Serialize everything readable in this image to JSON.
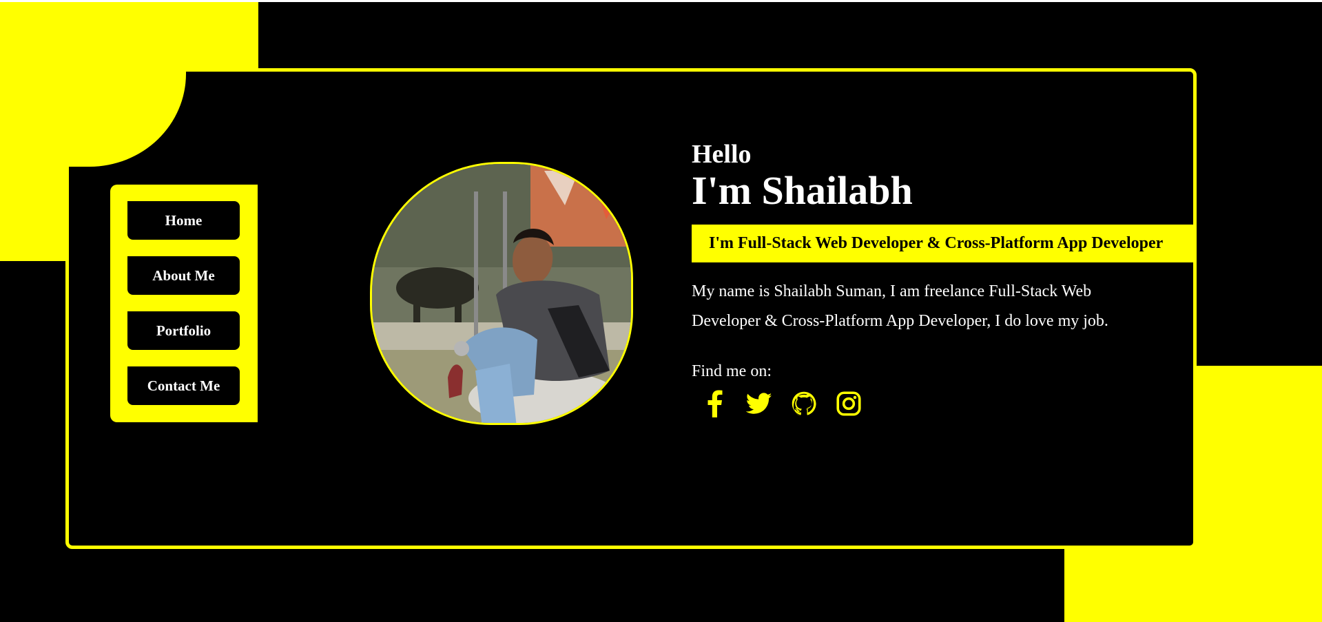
{
  "nav": {
    "items": [
      {
        "label": "Home"
      },
      {
        "label": "About Me"
      },
      {
        "label": "Portfolio"
      },
      {
        "label": "Contact Me"
      }
    ]
  },
  "hero": {
    "greeting": "Hello",
    "name": "I'm Shailabh",
    "role": "I'm Full-Stack Web Developer & Cross-Platform App Developer",
    "bio": "My name is Shailabh Suman, I am freelance Full-Stack Web Developer & Cross-Platform App Developer, I do love my job.",
    "find_label": "Find me on:",
    "socials": [
      {
        "icon": "facebook-icon"
      },
      {
        "icon": "twitter-icon"
      },
      {
        "icon": "github-icon"
      },
      {
        "icon": "instagram-icon"
      }
    ]
  },
  "colors": {
    "accent": "#ffff00",
    "background": "#000000",
    "text": "#ffffff"
  }
}
